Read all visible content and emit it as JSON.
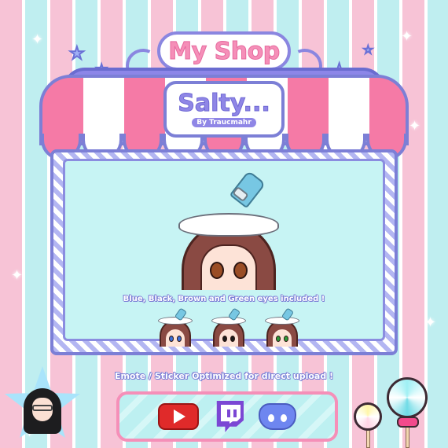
{
  "sign": {
    "title": "My Shop"
  },
  "brand": {
    "title": "Salty...",
    "byline": "By Traucmahr"
  },
  "description": {
    "eyes_included": "Blue, Black, Brown and Green eyes included !"
  },
  "variants": [
    {
      "eye_color": "#3b6fd9"
    },
    {
      "eye_color": "#1b1b1b"
    },
    {
      "eye_color": "#2f9b3a"
    }
  ],
  "footer": {
    "optimized": "Emote / Sticker Optimized for direct upload !"
  },
  "platforms": [
    {
      "name": "youtube-icon",
      "color": "#e02a2a"
    },
    {
      "name": "twitch-icon",
      "color": "#7b47d4"
    },
    {
      "name": "discord-icon",
      "color": "#6e86f0"
    }
  ],
  "colors": {
    "pink": "#f57aa6",
    "purple": "#7c7fd6",
    "mint": "#c7f4f4"
  }
}
